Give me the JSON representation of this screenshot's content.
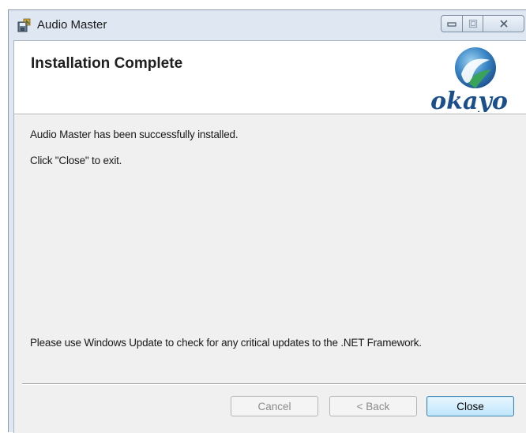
{
  "window": {
    "title": "Audio Master",
    "app_icon": "installer-disk-icon",
    "caption_icons": [
      "minimize-icon",
      "maximize-icon",
      "close-icon"
    ]
  },
  "banner": {
    "title": "Installation Complete",
    "logo_text": "okayo",
    "logo_icon": "okayo-logo-icon"
  },
  "body": {
    "message_installed": "Audio Master has been successfully installed.",
    "message_exit": "Click \"Close\" to exit.",
    "message_update": "Please use Windows Update to check for any critical updates to the .NET Framework."
  },
  "buttons": {
    "cancel": "Cancel",
    "back": "< Back",
    "close": "Close"
  },
  "colors": {
    "frame": "#dfe8f2",
    "client": "#f0f0f0",
    "logo_blue": "#1b4f8c",
    "logo_green": "#3aa35a",
    "default_button_border": "#3c7fb1"
  }
}
